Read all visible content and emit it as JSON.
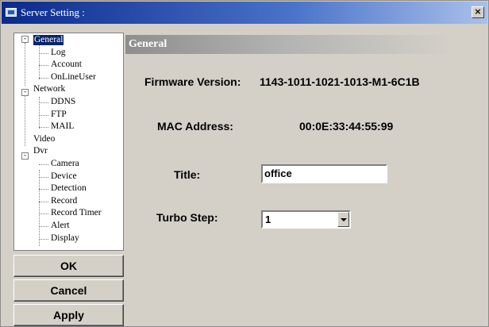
{
  "window": {
    "title": "Server Setting :",
    "close_label": "×"
  },
  "tree": {
    "items": [
      {
        "label": "General",
        "level": 0,
        "expanded": true,
        "selected": true
      },
      {
        "label": "Log",
        "level": 1
      },
      {
        "label": "Account",
        "level": 1
      },
      {
        "label": "OnLineUser",
        "level": 1
      },
      {
        "label": "Network",
        "level": 0,
        "expanded": true
      },
      {
        "label": "DDNS",
        "level": 1
      },
      {
        "label": "FTP",
        "level": 1
      },
      {
        "label": "MAIL",
        "level": 1
      },
      {
        "label": "Video",
        "level": 0
      },
      {
        "label": "Dvr",
        "level": 0,
        "expanded": true
      },
      {
        "label": "Camera",
        "level": 1
      },
      {
        "label": "Device",
        "level": 1
      },
      {
        "label": "Detection",
        "level": 1
      },
      {
        "label": "Record",
        "level": 1
      },
      {
        "label": "Record Timer",
        "level": 1
      },
      {
        "label": "Alert",
        "level": 1
      },
      {
        "label": "Display",
        "level": 1
      }
    ]
  },
  "buttons": {
    "ok": "OK",
    "cancel": "Cancel",
    "apply": "Apply"
  },
  "panel": {
    "header": "General",
    "firmware_label": "Firmware Version:",
    "firmware_value": "1143-1011-1021-1013-M1-6C1B",
    "mac_label": "MAC Address:",
    "mac_value": "00:0E:33:44:55:99",
    "title_label": "Title:",
    "title_value": "office",
    "turbo_label": "Turbo Step:",
    "turbo_value": "1"
  },
  "colors": {
    "titlebar": "#0b2a8c",
    "selection": "#0a246a",
    "face": "#d4d0c8"
  }
}
